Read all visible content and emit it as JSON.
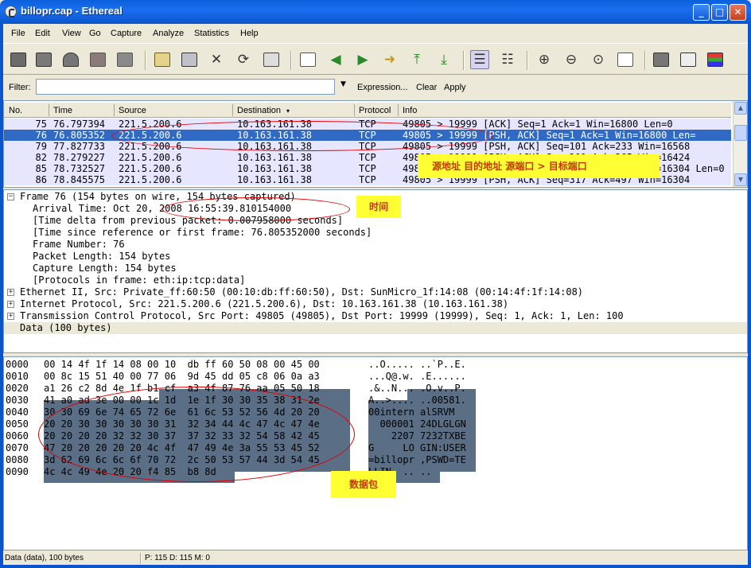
{
  "window": {
    "title": "billopr.cap - Ethereal"
  },
  "menu": [
    "File",
    "Edit",
    "View",
    "Go",
    "Capture",
    "Analyze",
    "Statistics",
    "Help"
  ],
  "toolbar_icons": [
    "interface-list-icon",
    "capture-options-icon",
    "capture-start-icon",
    "capture-stop-icon",
    "capture-restart-icon",
    "open-folder-icon",
    "save-icon",
    "close-icon",
    "reload-icon",
    "print-icon",
    "find-packet-icon",
    "go-back-icon",
    "go-forward-icon",
    "go-to-packet-icon",
    "go-first-icon",
    "go-last-icon",
    "colorize-icon",
    "autoscroll-icon",
    "zoom-in-icon",
    "zoom-out-icon",
    "normal-size-icon",
    "resize-columns-icon",
    "capture-filters-icon",
    "display-filters-icon",
    "coloring-rules-icon"
  ],
  "filter": {
    "label": "Filter:",
    "value": "",
    "expression": "Expression...",
    "clear": "Clear",
    "apply": "Apply"
  },
  "packet_list": {
    "columns": [
      "No.",
      "Time",
      "Source",
      "Destination",
      "Protocol",
      "Info"
    ],
    "rows": [
      {
        "no": "75",
        "time": "76.797394",
        "src": "221.5.200.6",
        "dst": "10.163.161.38",
        "proto": "TCP",
        "info": "49805 > 19999 [ACK] Seq=1 Ack=1 Win=16800 Len=0",
        "selected": false
      },
      {
        "no": "76",
        "time": "76.805352",
        "src": "221.5.200.6",
        "dst": "10.163.161.38",
        "proto": "TCP",
        "info": "49805 > 19999 [PSH, ACK] Seq=1 Ack=1 Win=16800 Len=",
        "selected": true
      },
      {
        "no": "79",
        "time": "77.827733",
        "src": "221.5.200.6",
        "dst": "10.163.161.38",
        "proto": "TCP",
        "info": "49805 > 19999 [PSH, ACK] Seq=101 Ack=233 Win=16568",
        "selected": false
      },
      {
        "no": "82",
        "time": "78.279227",
        "src": "221.5.200.6",
        "dst": "10.163.161.38",
        "proto": "TCP",
        "info": "49805 > 19999 [PSH, ACK] Seq=201 Ack=265 Win=16424",
        "selected": false
      },
      {
        "no": "85",
        "time": "78.732527",
        "src": "221.5.200.6",
        "dst": "10.163.161.38",
        "proto": "TCP",
        "info": "49805 > 19999 [PSH, ACK] Seq=301 Ack=409 Win=16304 Len=0",
        "selected": false
      },
      {
        "no": "86",
        "time": "78.845575",
        "src": "221.5.200.6",
        "dst": "10.163.161.38",
        "proto": "TCP",
        "info": "49805 > 19999 [PSH, ACK] Seq=317 Ack=497 Win=16304",
        "selected": false
      }
    ]
  },
  "details": {
    "frame": "Frame 76 (154 bytes on wire, 154 bytes captured)",
    "arrival": "Arrival Time: Oct 20, 2008 16:55:39.810154000",
    "delta": "[Time delta from previous packet: 0.007958000 seconds]",
    "since_ref": "[Time since reference or first frame: 76.805352000 seconds]",
    "frame_number": "Frame Number: 76",
    "packet_length": "Packet Length: 154 bytes",
    "capture_length": "Capture Length: 154 bytes",
    "protocols": "[Protocols in frame: eth:ip:tcp:data]",
    "ethernet": "Ethernet II, Src: Private_ff:60:50 (00:10:db:ff:60:50), Dst: SunMicro_1f:14:08 (00:14:4f:1f:14:08)",
    "ip": "Internet Protocol, Src: 221.5.200.6 (221.5.200.6), Dst: 10.163.161.38 (10.163.161.38)",
    "tcp": "Transmission Control Protocol, Src Port: 49805 (49805), Dst Port: 19999 (19999), Seq: 1, Ack: 1, Len: 100",
    "data": "Data (100 bytes)"
  },
  "hex": [
    {
      "off": "0000",
      "bytes": "00 14 4f 1f 14 08 00 10  db ff 60 50 08 00 45 00",
      "ascii": "..O..... ..`P..E."
    },
    {
      "off": "0010",
      "bytes": "00 8c 15 51 40 00 77 06  9d 45 dd 05 c8 06 0a a3",
      "ascii": "...Q@.w. .E......"
    },
    {
      "off": "0020",
      "bytes": "a1 26 c2 8d 4e 1f b1 cf  a3 4f 87 76 aa 05 50 18",
      "ascii": ".&..N... .O.v..P."
    },
    {
      "off": "0030",
      "bytes": "41 a0 ad 3e 00 00 1c 1d  1e 1f 30 30 35 38 31 2e",
      "ascii": "A..>.... ..00581."
    },
    {
      "off": "0040",
      "bytes": "30 30 69 6e 74 65 72 6e  61 6c 53 52 56 4d 20 20",
      "ascii": "00intern alSRVM  "
    },
    {
      "off": "0050",
      "bytes": "20 20 30 30 30 30 30 31  32 34 44 4c 47 4c 47 4e",
      "ascii": "  000001 24DLGLGN"
    },
    {
      "off": "0060",
      "bytes": "20 20 20 20 32 32 30 37  37 32 33 32 54 58 42 45",
      "ascii": "    2207 7232TXBE"
    },
    {
      "off": "0070",
      "bytes": "47 20 20 20 20 20 4c 4f  47 49 4e 3a 55 53 45 52",
      "ascii": "G     LO GIN:USER"
    },
    {
      "off": "0080",
      "bytes": "3d 62 69 6c 6c 6f 70 72  2c 50 53 57 44 3d 54 45",
      "ascii": "=billopr ,PSWD=TE"
    },
    {
      "off": "0090",
      "bytes": "4c 4c 49 4e 20 20 f4 85  b8 8d",
      "ascii": "LLIN  .. .."
    }
  ],
  "status": {
    "left": "Data (data), 100 bytes",
    "right": "P: 115 D: 115 M: 0"
  },
  "annotations": {
    "columns_note": "源地址   目的地址    源端口 > 目标端口",
    "time_note": "时间",
    "data_note": "数据包"
  },
  "colors": {
    "selected_row": "#316ac5",
    "row_bg": "#e7e6ff",
    "hex_selection": "#5a6e86",
    "annotation_bg": "#ffff33",
    "annotation_text": "#cc3300",
    "ellipse": "#e00000"
  }
}
